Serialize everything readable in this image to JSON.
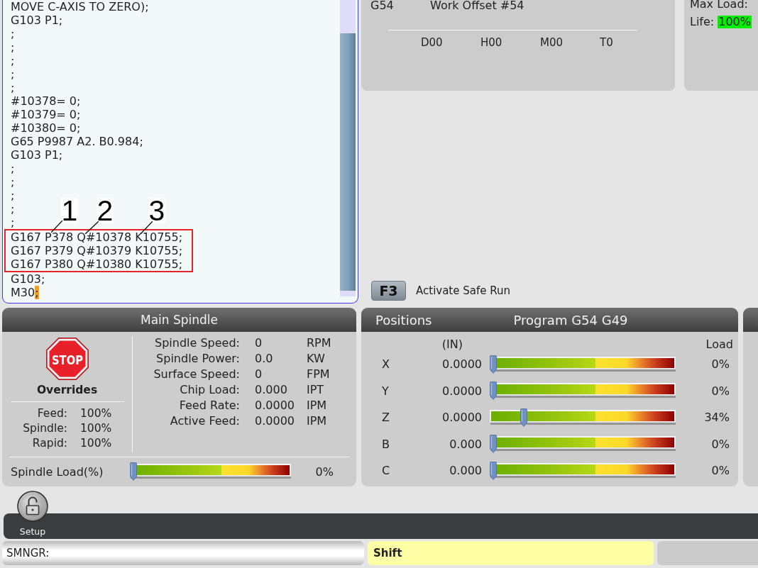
{
  "program": {
    "lines_before": [
      "MOVE C-AXIS TO ZERO);",
      "G103 P1;",
      ";",
      ";",
      ";",
      ";",
      ";",
      "#10378= 0;",
      "#10379= 0;",
      "#10380= 0;",
      "G65 P9987 A2. B0.984;",
      "G103 P1;",
      ";",
      ";",
      ";",
      ";",
      ";"
    ],
    "highlighted_block": {
      "callouts": [
        "1",
        "2",
        "3"
      ],
      "lines": [
        "G167 P378 Q#10378 K10755;",
        "G167 P379 Q#10379 K10755;",
        "G167 P380 Q#10380 K10755;"
      ]
    },
    "lines_after": [
      "G103;"
    ],
    "cursor_line": {
      "text": "M30",
      "cursor": ";"
    }
  },
  "work_offset": {
    "code": "G54",
    "name": "Work Offset #54",
    "active_codes": [
      "D00",
      "H00",
      "M00",
      "T0"
    ]
  },
  "tool_life": {
    "max_load_label": "Max Load:",
    "life_label": "Life:",
    "life_value": "100%"
  },
  "safe_run": {
    "key": "F3",
    "label": "Activate Safe Run"
  },
  "main_spindle": {
    "title": "Main Spindle",
    "stop_sign": "STOP",
    "overrides_title": "Overrides",
    "overrides": [
      {
        "label": "Feed:",
        "value": "100%"
      },
      {
        "label": "Spindle:",
        "value": "100%"
      },
      {
        "label": "Rapid:",
        "value": "100%"
      }
    ],
    "readings": [
      {
        "label": "Spindle Speed:",
        "value": "0",
        "unit": "RPM"
      },
      {
        "label": "Spindle Power:",
        "value": "0.0",
        "unit": "KW"
      },
      {
        "label": "Surface Speed:",
        "value": "0",
        "unit": "FPM"
      },
      {
        "label": "Chip Load:",
        "value": "0.000",
        "unit": "IPT"
      },
      {
        "label": "Feed Rate:",
        "value": "0.0000",
        "unit": "IPM"
      },
      {
        "label": "Active Feed:",
        "value": "0.0000",
        "unit": "IPM"
      }
    ],
    "load": {
      "label": "Spindle Load(%)",
      "level": 0,
      "reading": "0%"
    }
  },
  "positions": {
    "title": "Positions",
    "mode": "Program G54 G49",
    "units": "(IN)",
    "load_heading": "Load",
    "axes": [
      {
        "axis": "X",
        "value": "0.0000",
        "level": 0,
        "load": "0%"
      },
      {
        "axis": "Y",
        "value": "0.0000",
        "level": 0,
        "load": "0%"
      },
      {
        "axis": "Z",
        "value": "0.0000",
        "level": 0.17,
        "load": "34%"
      },
      {
        "axis": "B",
        "value": "0.000",
        "level": 0,
        "load": "0%"
      },
      {
        "axis": "C",
        "value": "0.000",
        "level": 0,
        "load": "0%"
      }
    ]
  },
  "toolbar": {
    "tabs": [
      {
        "label": "Setup"
      }
    ]
  },
  "status_bar": {
    "command_prompt": "SMNGR:",
    "shift_indicator": "Shift"
  }
}
